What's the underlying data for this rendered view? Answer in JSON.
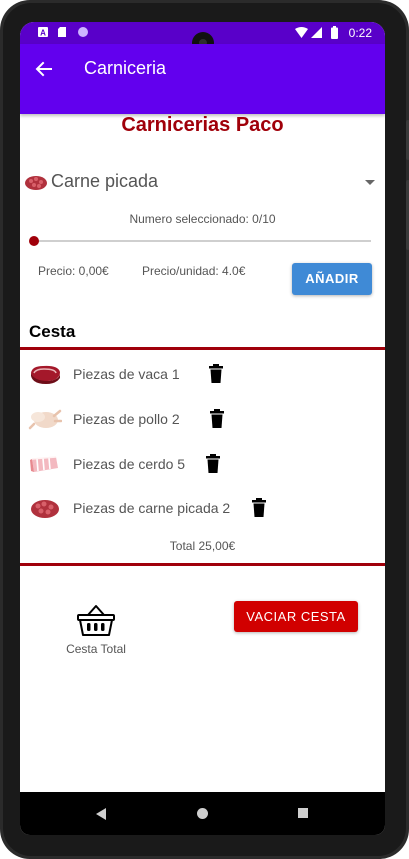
{
  "status_bar": {
    "time": "0:22"
  },
  "app_bar": {
    "title": "Carniceria"
  },
  "shop": {
    "title": "Carnicerias Paco"
  },
  "product_select": {
    "selected": "Carne picada",
    "icon": "ground-meat-icon"
  },
  "quantity": {
    "label": "Numero seleccionado: 0/10",
    "value": 0,
    "max": 10
  },
  "price": {
    "total": "Precio: 0,00€",
    "unit": "Precio/unidad: 4.0€"
  },
  "buttons": {
    "add": "AÑADIR",
    "empty": "VACIAR CESTA"
  },
  "basket": {
    "heading": "Cesta",
    "items": [
      {
        "label": "Piezas de vaca 1",
        "icon": "beef-steak-icon"
      },
      {
        "label": "Piezas de pollo 2",
        "icon": "chicken-icon"
      },
      {
        "label": "Piezas de cerdo 5",
        "icon": "pork-icon"
      },
      {
        "label": "Piezas de carne picada 2",
        "icon": "ground-meat-icon"
      }
    ],
    "total": "Total 25,00€",
    "total_label": "Cesta Total"
  },
  "colors": {
    "primary": "#6200ee",
    "status": "#5900c9",
    "accent": "#a0000a",
    "add_button": "#3f8ad6",
    "empty_button": "#d10000"
  }
}
